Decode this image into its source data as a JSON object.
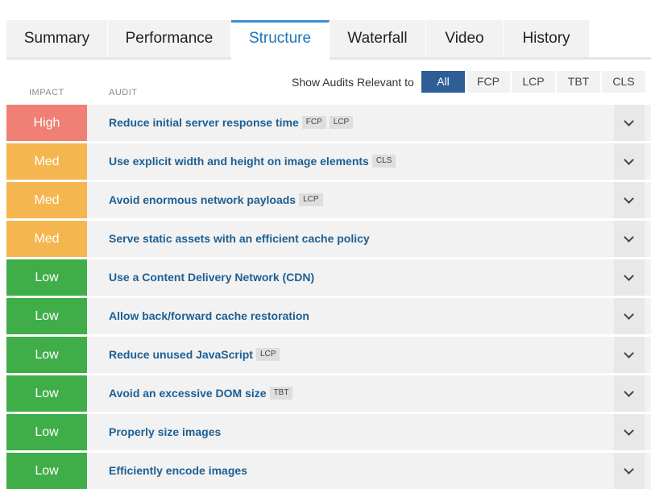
{
  "tabs": [
    {
      "label": "Summary",
      "active": false
    },
    {
      "label": "Performance",
      "active": false
    },
    {
      "label": "Structure",
      "active": true
    },
    {
      "label": "Waterfall",
      "active": false
    },
    {
      "label": "Video",
      "active": false
    },
    {
      "label": "History",
      "active": false
    }
  ],
  "columns": {
    "impact": "IMPACT",
    "audit": "AUDIT"
  },
  "filter": {
    "label": "Show Audits Relevant to",
    "options": [
      "All",
      "FCP",
      "LCP",
      "TBT",
      "CLS"
    ],
    "selected": "All"
  },
  "impact_colors": {
    "High": "#f07f74",
    "Med": "#f5b64f",
    "Low": "#3fae49"
  },
  "audits": [
    {
      "impact": "High",
      "title": "Reduce initial server response time",
      "tags": [
        "FCP",
        "LCP"
      ]
    },
    {
      "impact": "Med",
      "title": "Use explicit width and height on image elements",
      "tags": [
        "CLS"
      ]
    },
    {
      "impact": "Med",
      "title": "Avoid enormous network payloads",
      "tags": [
        "LCP"
      ]
    },
    {
      "impact": "Med",
      "title": "Serve static assets with an efficient cache policy",
      "tags": []
    },
    {
      "impact": "Low",
      "title": "Use a Content Delivery Network (CDN)",
      "tags": []
    },
    {
      "impact": "Low",
      "title": "Allow back/forward cache restoration",
      "tags": []
    },
    {
      "impact": "Low",
      "title": "Reduce unused JavaScript",
      "tags": [
        "LCP"
      ]
    },
    {
      "impact": "Low",
      "title": "Avoid an excessive DOM size",
      "tags": [
        "TBT"
      ]
    },
    {
      "impact": "Low",
      "title": "Properly size images",
      "tags": []
    },
    {
      "impact": "Low",
      "title": "Efficiently encode images",
      "tags": []
    }
  ]
}
